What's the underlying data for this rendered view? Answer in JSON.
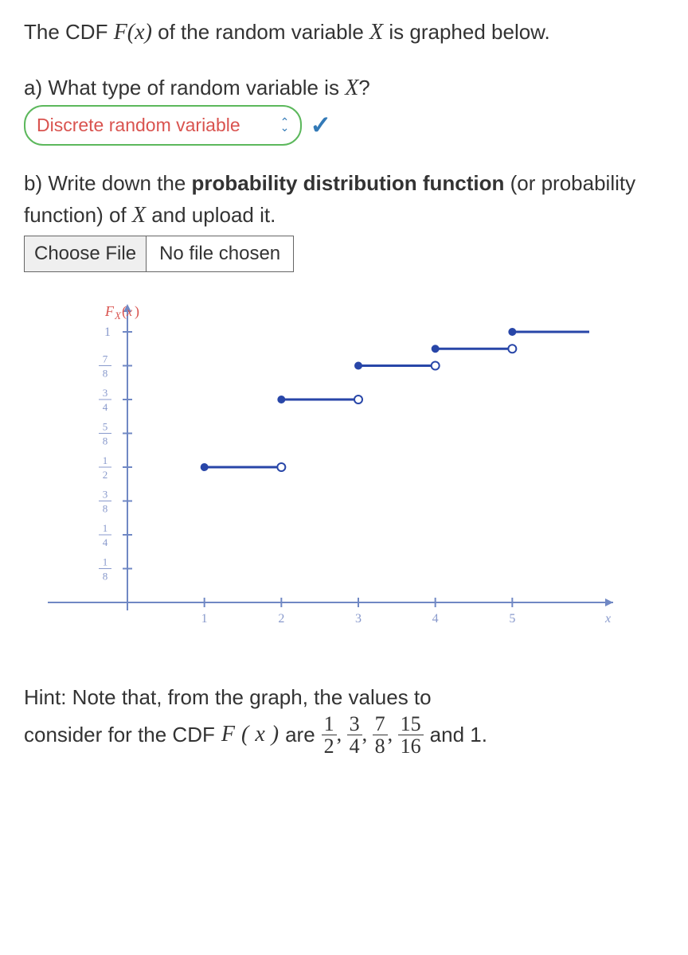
{
  "intro": {
    "pre": "The CDF ",
    "F": "F",
    "x": "x",
    "mid": " of the random variable ",
    "X": "X",
    "post": " is graphed below."
  },
  "partA": {
    "prefix": "a) What type of random variable is ",
    "X": "X",
    "q": "?",
    "selected": "Discrete random variable"
  },
  "partB": {
    "prefix": "b) Write down the ",
    "bold": "probability distribution function",
    "suffix": " (or probability function) of ",
    "X": "X",
    "tail": " and upload it.",
    "choose": "Choose File",
    "nofile": "No file chosen"
  },
  "chart_data": {
    "type": "step",
    "title_label": "F_X(x)",
    "xlabel": "x",
    "ylim": [
      0,
      1
    ],
    "xlim": [
      0,
      5.5
    ],
    "y_ticks": [
      "1/8",
      "1/4",
      "3/8",
      "1/2",
      "5/8",
      "3/4",
      "7/8",
      "1"
    ],
    "x_ticks": [
      1,
      2,
      3,
      4,
      5
    ],
    "steps": [
      {
        "x_start": 1,
        "x_end": 2,
        "y": 0.5,
        "closed_left": true,
        "open_right": true
      },
      {
        "x_start": 2,
        "x_end": 3,
        "y": 0.75,
        "closed_left": true,
        "open_right": true
      },
      {
        "x_start": 3,
        "x_end": 4,
        "y": 0.875,
        "closed_left": true,
        "open_right": true
      },
      {
        "x_start": 4,
        "x_end": 5,
        "y": 0.9375,
        "closed_left": true,
        "open_right": true
      },
      {
        "x_start": 5,
        "x_end": 6,
        "y": 1.0,
        "closed_left": true,
        "open_right": false
      }
    ]
  },
  "hint": {
    "line1a": "Hint: Note that, from the graph, the values to",
    "line2a": "consider for the CDF ",
    "F": "F",
    "x": "x",
    "are": " are ",
    "fracs": [
      {
        "n": "1",
        "d": "2"
      },
      {
        "n": "3",
        "d": "4"
      },
      {
        "n": "7",
        "d": "8"
      },
      {
        "n": "15",
        "d": "16"
      }
    ],
    "and1": " and 1."
  }
}
